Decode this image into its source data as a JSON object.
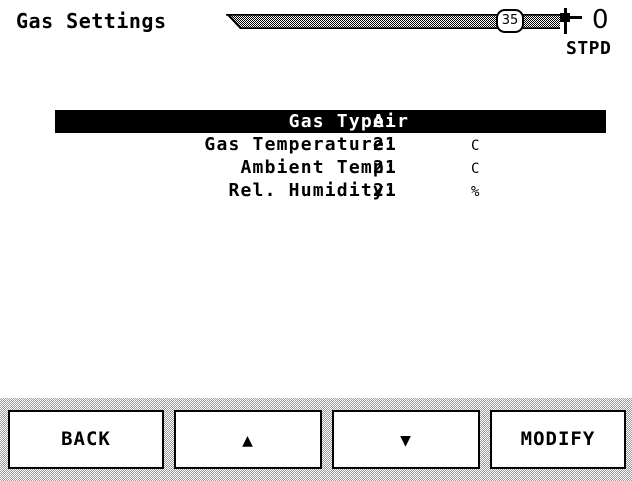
{
  "header": {
    "title": "Gas Settings",
    "pressure_value": "35",
    "flow_value": "0",
    "unit_mode": "STPD",
    "icons": {
      "battery": "battery-plug-icon",
      "gauge": "pressure-gauge-icon"
    }
  },
  "settings": {
    "rows": [
      {
        "label": "Gas Type:",
        "value": "Air",
        "unit": "",
        "selected": true
      },
      {
        "label": "Gas Temperature:",
        "value": "21",
        "unit": "C",
        "selected": false
      },
      {
        "label": "Ambient Temp:",
        "value": "21",
        "unit": "C",
        "selected": false
      },
      {
        "label": "Rel. Humidity:",
        "value": "21",
        "unit": "%",
        "selected": false
      }
    ]
  },
  "softkeys": {
    "back": "BACK",
    "up": "▲",
    "down": "▼",
    "modify": "MODIFY"
  },
  "colors": {
    "background": "#ffffff",
    "foreground": "#000000",
    "softkey_bar_pattern": "#9a9a9a"
  }
}
